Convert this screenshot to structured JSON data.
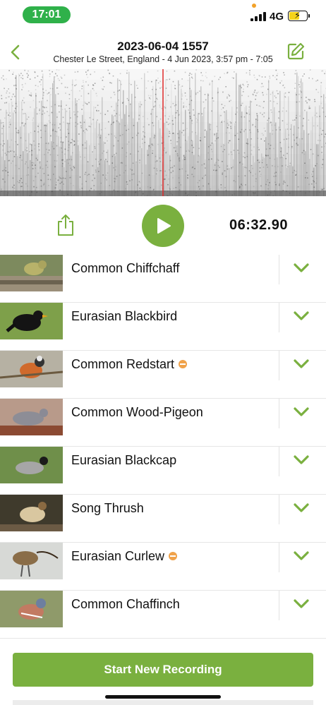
{
  "status_bar": {
    "time": "17:01",
    "network": "4G",
    "battery_level": 0.55,
    "colors": {
      "time_pill": "#2fb14a",
      "battery_fill": "#f5d31a"
    }
  },
  "header": {
    "title": "2023-06-04 1557",
    "subtitle": "Chester Le Street, England - 4 Jun 2023, 3:57 pm - 7:05",
    "back_icon": "chevron-left-icon",
    "edit_icon": "edit-icon"
  },
  "spectrogram": {
    "playhead_fraction": 0.5,
    "playhead_color": "#e02a2a"
  },
  "playback": {
    "share_icon": "share-icon",
    "play_icon": "play-icon",
    "elapsed": "06:32.90"
  },
  "species": [
    {
      "name": "Common Chiffchaff",
      "rare": false
    },
    {
      "name": "Eurasian Blackbird",
      "rare": false
    },
    {
      "name": "Common Redstart",
      "rare": true
    },
    {
      "name": "Common Wood-Pigeon",
      "rare": false
    },
    {
      "name": "Eurasian Blackcap",
      "rare": false
    },
    {
      "name": "Song Thrush",
      "rare": false
    },
    {
      "name": "Eurasian Curlew",
      "rare": true
    },
    {
      "name": "Common Chaffinch",
      "rare": false
    }
  ],
  "footer": {
    "start_label": "Start New Recording"
  },
  "colors": {
    "accent": "#7ab03f",
    "rarity": "#f0a24a"
  }
}
